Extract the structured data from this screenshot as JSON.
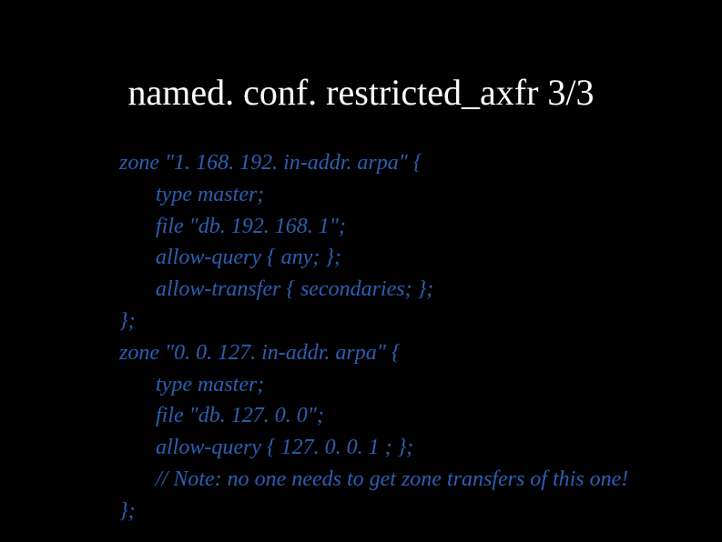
{
  "title": "named. conf. restricted_axfr 3/3",
  "lines": [
    {
      "cls": "",
      "text": "zone \"1. 168. 192. in-addr. arpa\" {"
    },
    {
      "cls": "ind1",
      "text": "type master;"
    },
    {
      "cls": "ind1",
      "text": "file \"db. 192. 168. 1\";"
    },
    {
      "cls": "ind1",
      "text": "allow-query { any; };"
    },
    {
      "cls": "ind1",
      "text": "allow-transfer { secondaries; };"
    },
    {
      "cls": "",
      "text": "};"
    },
    {
      "cls": "",
      "text": "zone \"0. 0. 127. in-addr. arpa\" {"
    },
    {
      "cls": "ind1",
      "text": "type master;"
    },
    {
      "cls": "ind1",
      "text": "file \"db. 127. 0. 0\";"
    },
    {
      "cls": "ind1",
      "text": "allow-query { 127. 0. 0. 1 ; };"
    },
    {
      "cls": "ind1",
      "text": "// Note: no one needs to get zone transfers of this one!"
    },
    {
      "cls": "",
      "text": "};"
    }
  ]
}
